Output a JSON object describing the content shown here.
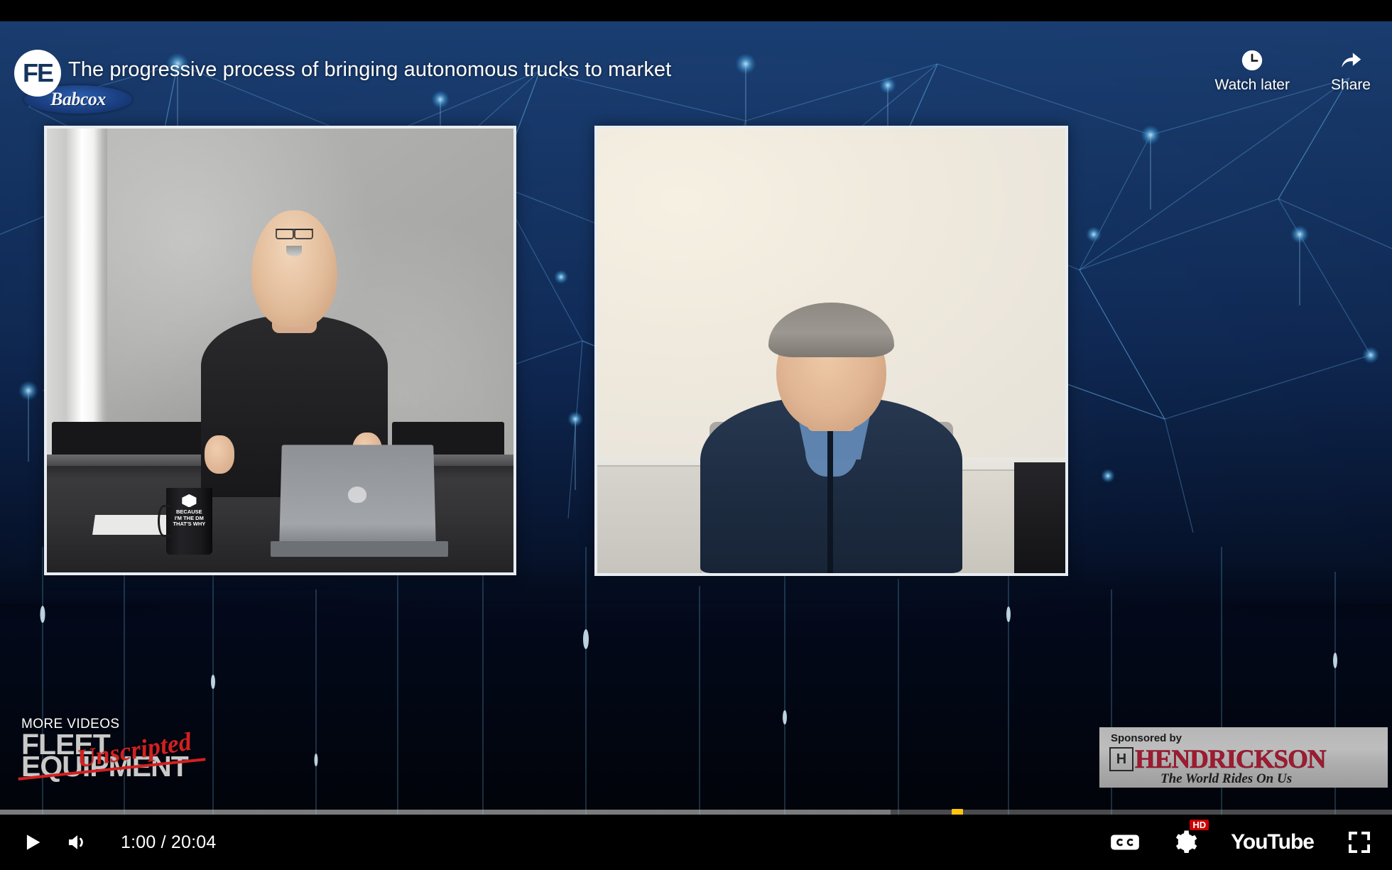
{
  "player": {
    "title": "The progressive process of bringing autonomous trucks to market",
    "brand_badge": "FE",
    "brand_publisher": "Babcox"
  },
  "top_actions": [
    {
      "label": "Watch later",
      "icon": "clock-icon"
    },
    {
      "label": "Share",
      "icon": "share-arrow-icon"
    }
  ],
  "more_videos": {
    "label": "MORE VIDEOS",
    "logo_line1": "FLEET",
    "logo_line2": "EQUIPMENT",
    "logo_script": "Unscripted"
  },
  "sponsor": {
    "prefix": "Sponsored by",
    "mark": "H",
    "name": "HENDRICKSON",
    "tagline": "The World Rides On Us",
    "brand_color": "#9e1b32"
  },
  "progress": {
    "played_percent": 0,
    "loaded_percent": 64,
    "chapter_marker_percent": 68.8,
    "played_color": "#cc0000",
    "marker_color": "#ffc40c"
  },
  "controls": {
    "play_label": "Play",
    "volume_label": "Mute",
    "time": "1:00 / 20:04",
    "current_time": "1:00",
    "duration": "20:04",
    "captions_label": "CC",
    "settings_label": "Settings",
    "quality_badge": "HD",
    "youtube_label": "YouTube",
    "fullscreen_label": "Full screen"
  },
  "scene": {
    "left_pane_name": "Host video feed",
    "right_pane_name": "Guest video feed",
    "mug_text_line1": "BECAUSE",
    "mug_text_line2": "I'M THE DM",
    "mug_text_line3": "THAT'S WHY"
  }
}
